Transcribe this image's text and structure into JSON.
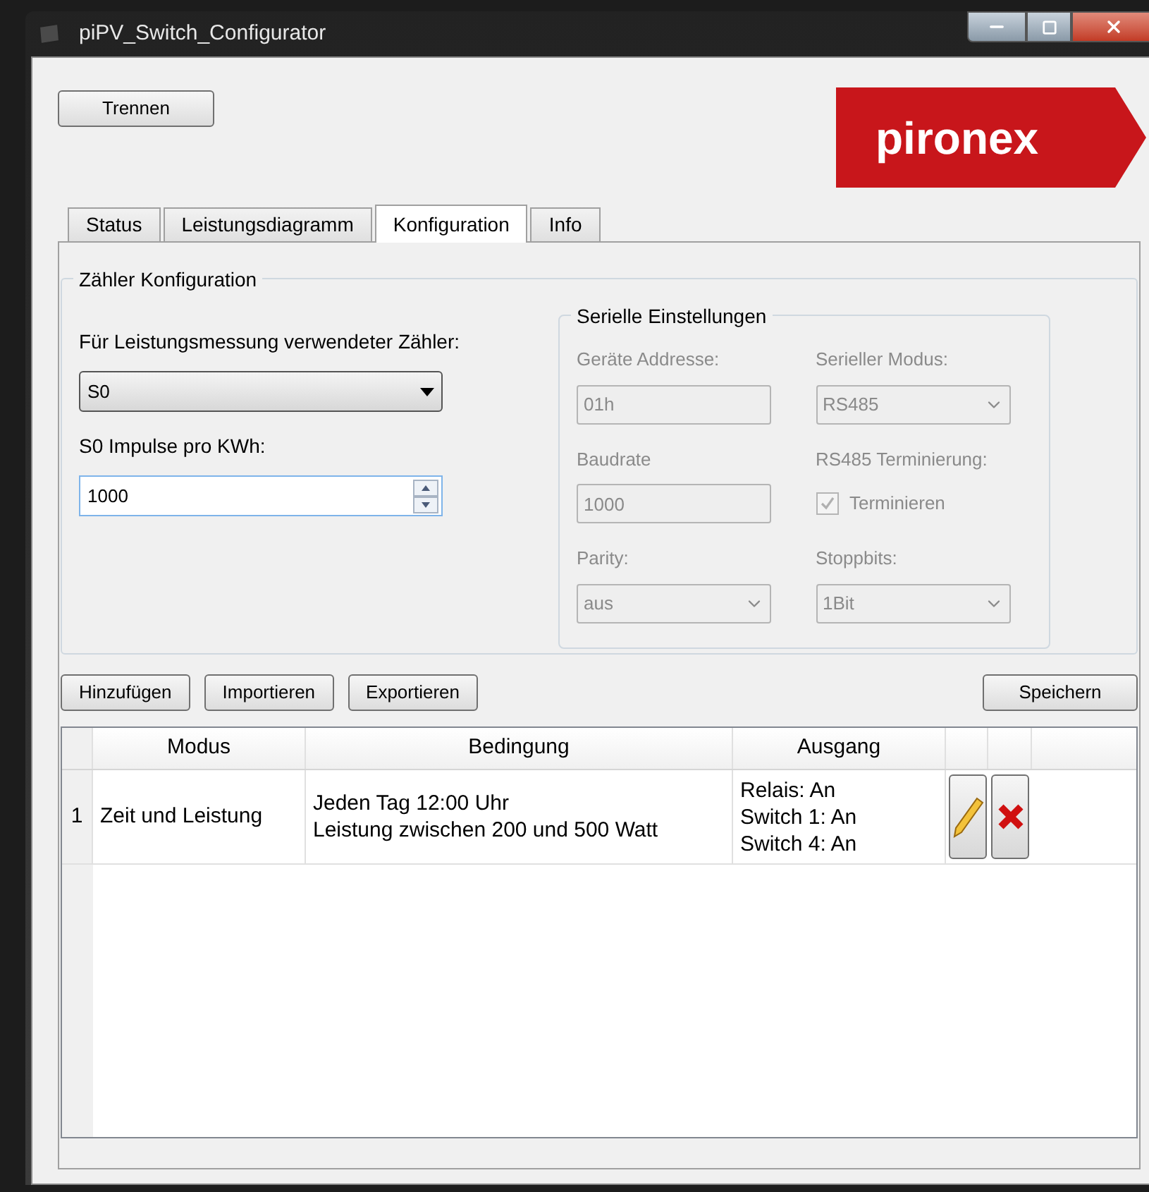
{
  "window": {
    "title": "piPV_Switch_Configurator"
  },
  "disconnect_button": "Trennen",
  "logo": {
    "text": "pironex"
  },
  "tabs": [
    {
      "label": "Status",
      "selected": false
    },
    {
      "label": "Leistungsdiagramm",
      "selected": false
    },
    {
      "label": "Konfiguration",
      "selected": true
    },
    {
      "label": "Info",
      "selected": false
    }
  ],
  "meter_group": {
    "title": "Zähler Konfiguration",
    "meter_label": "Für Leistungsmessung verwendeter Zähler:",
    "meter_value": "S0",
    "pulses_label": "S0 Impulse pro KWh:",
    "pulses_value": "1000"
  },
  "serial_group": {
    "title": "Serielle Einstellungen",
    "disabled": true,
    "fields": [
      {
        "kind": "text",
        "label": "Geräte Addresse:",
        "value": "01h"
      },
      {
        "kind": "select",
        "label": "Serieller Modus:",
        "value": "RS485"
      },
      {
        "kind": "text",
        "label": "Baudrate",
        "value": "1000"
      },
      {
        "kind": "checkbox",
        "label": "RS485 Terminierung:",
        "value": "Terminieren",
        "checked": true
      },
      {
        "kind": "select",
        "label": "Parity:",
        "value": "aus"
      },
      {
        "kind": "select",
        "label": "Stoppbits:",
        "value": "1Bit"
      }
    ]
  },
  "actions": [
    "Hinzufügen",
    "Importieren",
    "Exportieren"
  ],
  "save_button": "Speichern",
  "table": {
    "columns": [
      "Modus",
      "Bedingung",
      "Ausgang"
    ],
    "rows": [
      {
        "number": "1",
        "modus": "Zeit und Leistung",
        "bedingung": [
          "Jeden Tag 12:00 Uhr",
          "Leistung zwischen 200 und 500 Watt"
        ],
        "ausgang": [
          "Relais: An",
          "Switch 1: An",
          "Switch 4: An"
        ]
      }
    ]
  }
}
